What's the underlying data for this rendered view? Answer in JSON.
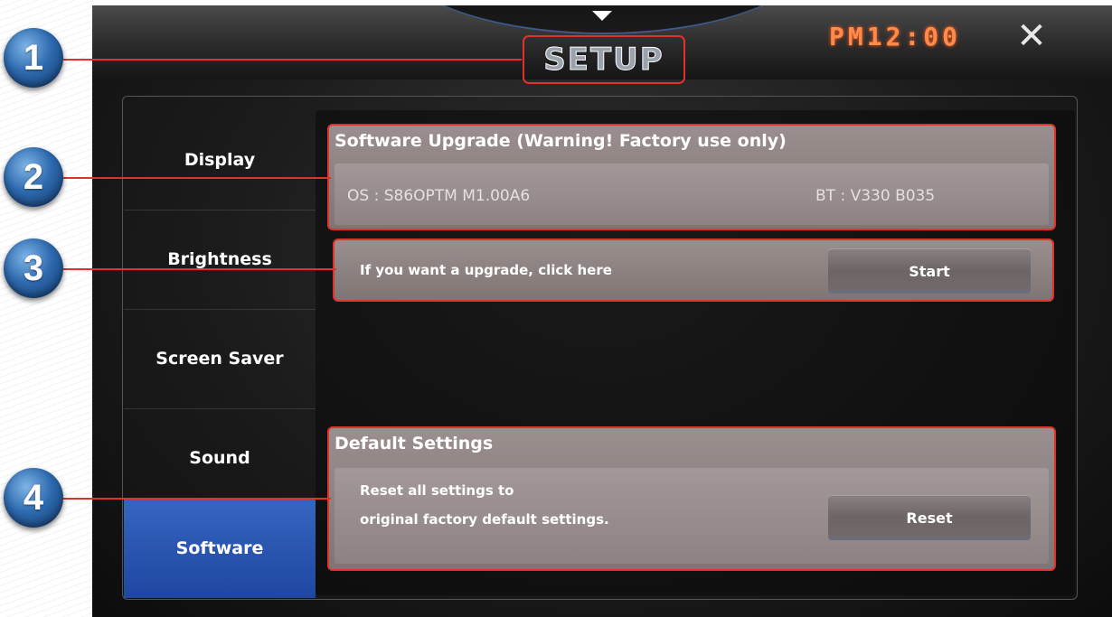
{
  "header": {
    "title": "SETUP",
    "clock": "PM12:00",
    "close_glyph": "✕",
    "arrow_icon": "chevron-down-icon"
  },
  "sidebar": {
    "items": [
      {
        "label": "Display",
        "active": false
      },
      {
        "label": "Brightness",
        "active": false
      },
      {
        "label": "Screen Saver",
        "active": false
      },
      {
        "label": "Sound",
        "active": false
      },
      {
        "label": "Software",
        "active": true
      }
    ]
  },
  "software_upgrade": {
    "title": "Software Upgrade (Warning! Factory use only)",
    "os_version": "OS : S86OPTM M1.00A6",
    "bt_version": "BT : V330 B035",
    "prompt": "If you want a upgrade, click here",
    "start_label": "Start"
  },
  "default_settings": {
    "title": "Default Settings",
    "line1": "Reset all settings to",
    "line2": "original factory default settings.",
    "reset_label": "Reset"
  },
  "callouts": [
    "1",
    "2",
    "3",
    "4"
  ],
  "colors": {
    "accent_active": "#2a55b0",
    "highlight_border": "#e0312a",
    "clock": "#ff8a4a",
    "badge": "#2e6bb0"
  }
}
